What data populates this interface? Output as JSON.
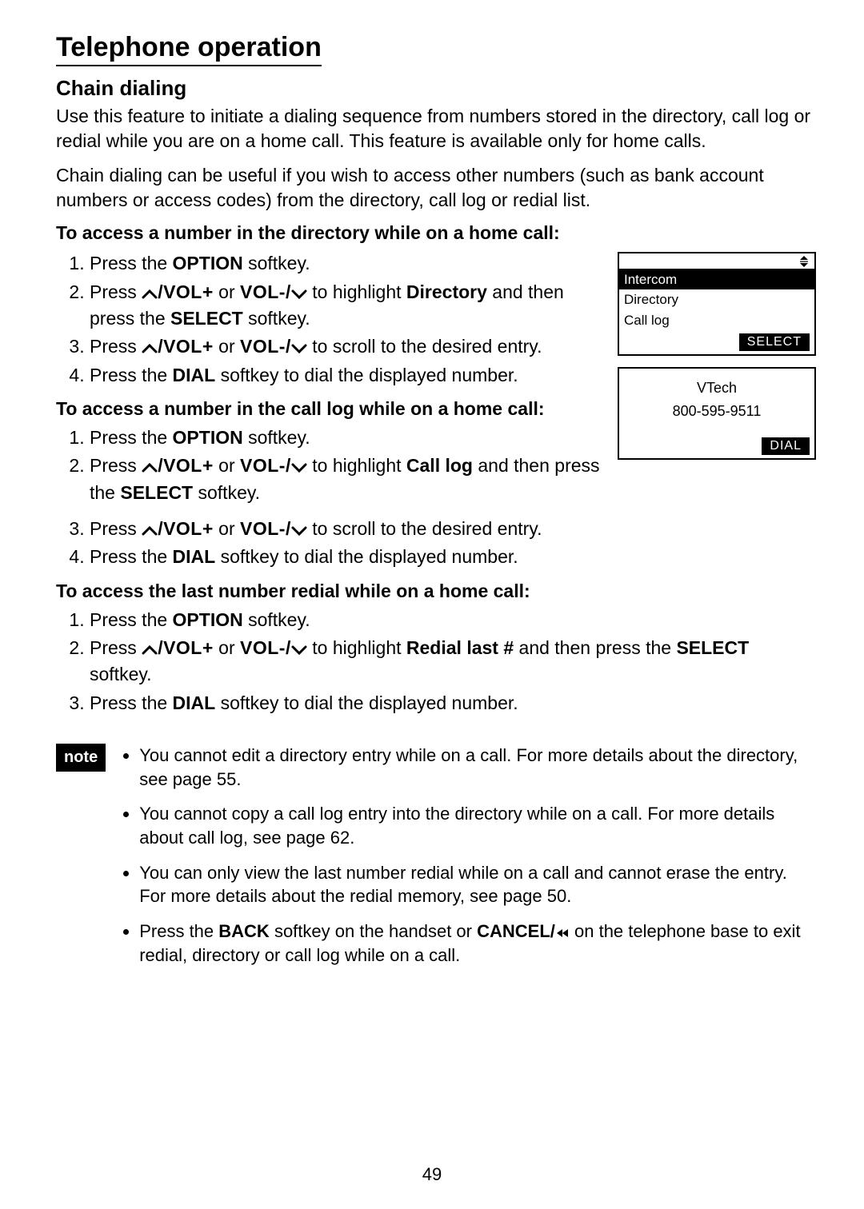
{
  "title": "Telephone operation",
  "subtitle": "Chain dialing",
  "intro1": "Use this feature to initiate a dialing sequence from numbers stored in the directory, call log or redial while you are on a home call. This feature is available only for home calls.",
  "intro2": "Chain dialing can be useful if you wish to access other numbers (such as bank account numbers or access codes) from the directory, call log or redial list.",
  "sub1": "To access a number in the directory while on a home call:",
  "sub2": "To access a number in the call log while on a home call:",
  "sub3": "To access the last number redial while on a home call:",
  "press_the": "Press the ",
  "option": "OPTION",
  "softkey_end": " softkey.",
  "press": "Press ",
  "vol_plus": "VOL+",
  "vol_minus": "VOL-",
  "or": " or ",
  "slash": "/",
  "hl_dir_a": " to highlight ",
  "hl_dir_b": "Directory",
  "hl_dir_c": " and then press the ",
  "hl_cl_b": "Call log",
  "hl_rl_b": "Redial last #",
  "hl_rl_c": " and then press the ",
  "select": "SELECT",
  "scroll_tail": " to scroll to the desired entry.",
  "dial": "DIAL",
  "dial_tail": " softkey to dial the displayed number.",
  "lcd1": {
    "r1": "Intercom",
    "r2": "Directory",
    "r3": "Call log",
    "soft": "SELECT"
  },
  "lcd2": {
    "r1": "VTech",
    "r2": "800-595-9511",
    "soft": "DIAL"
  },
  "note_label": "note",
  "notes": {
    "n1": "You cannot edit a directory entry while on a call. For more details about the directory, see page 55.",
    "n2": "You cannot copy a call log entry into the directory while on a call. For more details about call log, see page 62.",
    "n3": "You can only view the last number redial while on a call and cannot erase the entry. For more details about the redial memory, see page 50.",
    "n4a": "Press the ",
    "n4b": "BACK",
    "n4c": " softkey on the handset or ",
    "n4d": "CANCEL/",
    "n4e": " on the telephone base to exit redial, directory or call log while on a call."
  },
  "pagenum": "49"
}
